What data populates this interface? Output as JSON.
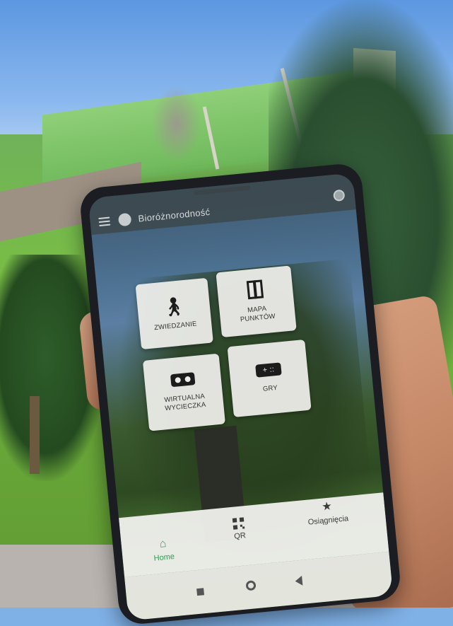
{
  "app": {
    "title": "Bioróżnorodność"
  },
  "tiles": [
    {
      "label": "ZWIEDZANIE",
      "icon": "walking-person-icon"
    },
    {
      "label": "MAPA\nPUNKTÓW",
      "icon": "map-icon"
    },
    {
      "label": "WIRTUALNA\nWYCIECZKA",
      "icon": "vr-headset-icon"
    },
    {
      "label": "GRY",
      "icon": "gamepad-icon"
    }
  ],
  "bottom_nav": {
    "items": [
      {
        "label": "Home",
        "icon": "home-icon",
        "active": true
      },
      {
        "label": "QR",
        "icon": "qr-code-icon",
        "active": false
      },
      {
        "label": "Osiągnięcia",
        "icon": "star-icon",
        "active": false
      }
    ]
  },
  "colors": {
    "active_nav": "#2e9d4e",
    "tile_bg": "#ececE8",
    "appbar_bg": "#3c484c"
  }
}
